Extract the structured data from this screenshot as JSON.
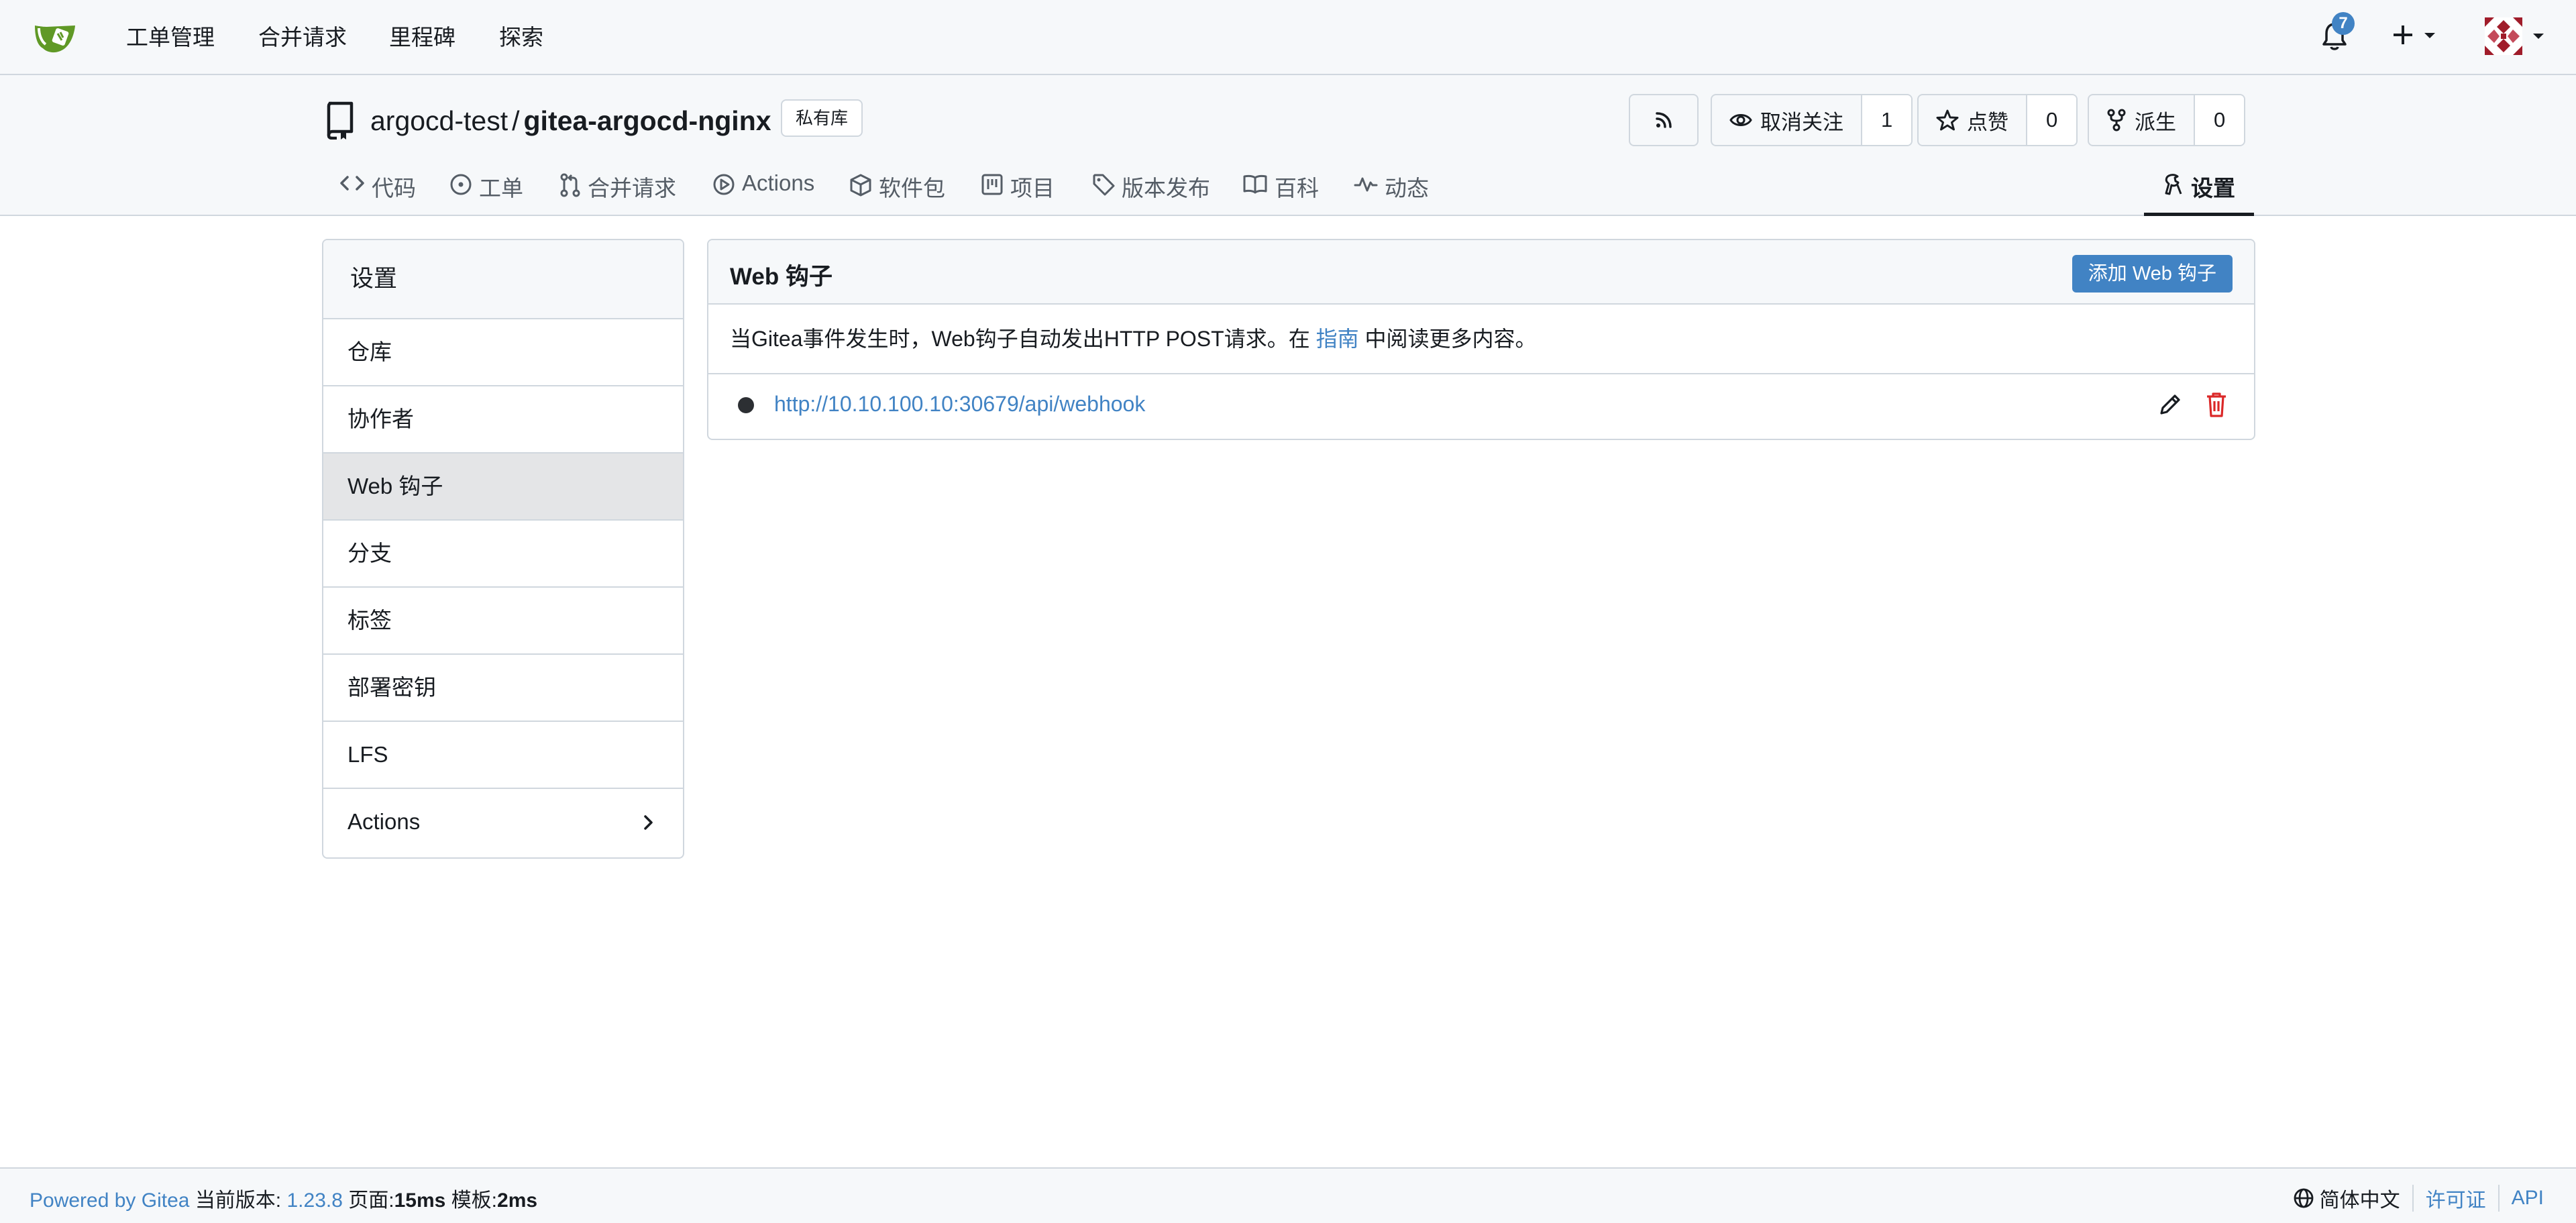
{
  "nav": {
    "items": [
      "工单管理",
      "合并请求",
      "里程碑",
      "探索"
    ],
    "notification_count": "7",
    "logo_icon": "gitea-logo-icon",
    "accent": "#4183c4"
  },
  "repo": {
    "owner": "argocd-test",
    "separator": "/",
    "name": "gitea-argocd-nginx",
    "private_label": "私有库",
    "unwatch_label": "取消关注",
    "watch_count": "1",
    "star_label": "点赞",
    "star_count": "0",
    "fork_label": "派生",
    "fork_count": "0"
  },
  "tabs": [
    "代码",
    "工单",
    "合并请求",
    "Actions",
    "软件包",
    "项目",
    "版本发布",
    "百科",
    "动态"
  ],
  "settings_tab": "设置",
  "sidebar": {
    "title": "设置",
    "items": [
      "仓库",
      "协作者",
      "Web 钩子",
      "分支",
      "标签",
      "部署密钥",
      "LFS",
      "Actions"
    ],
    "active_index": 2
  },
  "webhooks": {
    "title": "Web 钩子",
    "add_button": "添加 Web 钩子",
    "desc_prefix": "当Gitea事件发生时，Web钩子自动发出HTTP POST请求。在",
    "desc_link": "指南",
    "desc_suffix": "中阅读更多内容。",
    "items": [
      {
        "url": "http://10.10.100.10:30679/api/webhook"
      }
    ]
  },
  "footer": {
    "powered_by": "Powered by Gitea",
    "version_label": "当前版本:",
    "version": "1.23.8",
    "page_label": "页面:",
    "page_time": "15ms",
    "template_label": "模板:",
    "template_time": "2ms",
    "language": "简体中文",
    "license_link": "许可证",
    "api_link": "API"
  }
}
